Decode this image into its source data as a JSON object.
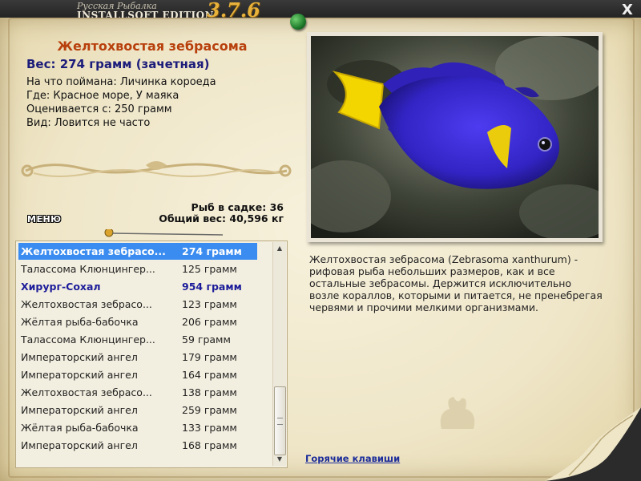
{
  "header": {
    "logo_line1": "Русская Рыбалка",
    "logo_line2": "INSTALLSOFT EDITION",
    "version": "3.7.6",
    "close_label": "X"
  },
  "fish": {
    "title": "Желтохвостая зебрасома",
    "weight": "Вес: 274 грамм (зачетная)",
    "bait": "На что поймана: Личинка короеда",
    "place": "Где: Красное море, У маяка",
    "valued": "Оценивается с: 250 грамм",
    "kind": "Вид: Ловится не часто",
    "description": "Желтохвостая зебрасома (Zebrasoma xanthurum) - рифовая рыба небольших размеров, как и все остальные зебрасомы. Держится исключительно возле кораллов, которыми и питается, не пренебрегая червями и прочими мелкими организмами."
  },
  "stats": {
    "in_cage": "Рыб в садке: 36",
    "total_weight": "Общий вес: 40,596 кг"
  },
  "menu_label": "МЕНЮ",
  "hotkeys_label": "Горячие клавиши",
  "catch_list": [
    {
      "name": "Желтохвостая зебрасо...",
      "weight": "274 грамм",
      "state": "selected"
    },
    {
      "name": "Талассома Клюнцингер...",
      "weight": "125 грамм",
      "state": ""
    },
    {
      "name": "Хирург-Сохал",
      "weight": "954 грамм",
      "state": "trophy"
    },
    {
      "name": "Желтохвостая зебрасо...",
      "weight": "123 грамм",
      "state": ""
    },
    {
      "name": "Жёлтая рыба-бабочка",
      "weight": "206 грамм",
      "state": ""
    },
    {
      "name": "Талассома Клюнцингер...",
      "weight": "59 грамм",
      "state": ""
    },
    {
      "name": "Императорский ангел",
      "weight": "179 грамм",
      "state": ""
    },
    {
      "name": "Императорский ангел",
      "weight": "164 грамм",
      "state": ""
    },
    {
      "name": "Желтохвостая зебрасо...",
      "weight": "138 грамм",
      "state": ""
    },
    {
      "name": "Императорский ангел",
      "weight": "259 грамм",
      "state": ""
    },
    {
      "name": "Жёлтая рыба-бабочка",
      "weight": "133 грамм",
      "state": ""
    },
    {
      "name": "Императорский ангел",
      "weight": "168 грамм",
      "state": ""
    }
  ],
  "colors": {
    "title": "#b8400d",
    "selection": "#3b8cf0",
    "trophy": "#1c1c9a",
    "fish_body": "#3b2fd6",
    "fish_tail": "#f3d500"
  }
}
